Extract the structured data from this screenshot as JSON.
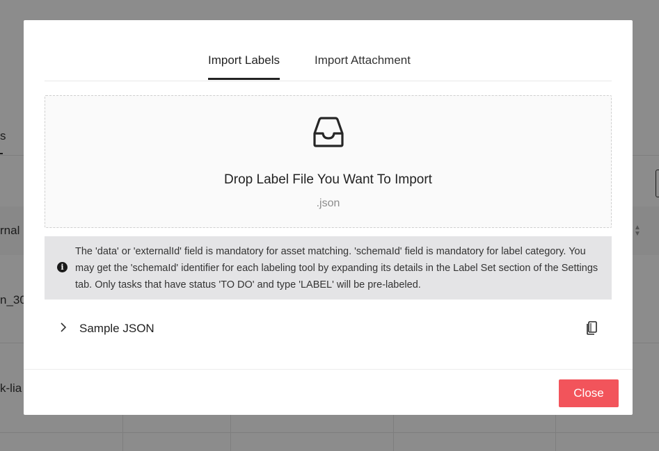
{
  "background": {
    "tab_fragment": "s",
    "header_fragment": "rnal",
    "row1_fragment": "n_30",
    "row2_fragment": "k-lia"
  },
  "modal": {
    "tabs": [
      {
        "label": "Import Labels",
        "active": true
      },
      {
        "label": "Import Attachment",
        "active": false
      }
    ],
    "dropzone": {
      "icon": "inbox-icon",
      "title": "Drop Label File You Want To Import",
      "accepted_ext": ".json"
    },
    "info": {
      "icon": "info-icon",
      "text": "The 'data' or 'externalId' field is mandatory for asset matching. 'schemaId' field is mandatory for label category. You may get the 'schemaId' identifier for each labeling tool by expanding its details in the Label Set section of the Settings tab. Only tasks that have status 'TO DO' and type 'LABEL' will be pre-labeled."
    },
    "sample": {
      "label": "Sample JSON",
      "expand_icon": "chevron-right-icon",
      "copy_icon": "copy-icon"
    },
    "footer": {
      "close_label": "Close"
    }
  },
  "colors": {
    "accent": "#f2545b",
    "info_bg": "#e4e4e6",
    "active_tab": "#222222"
  }
}
